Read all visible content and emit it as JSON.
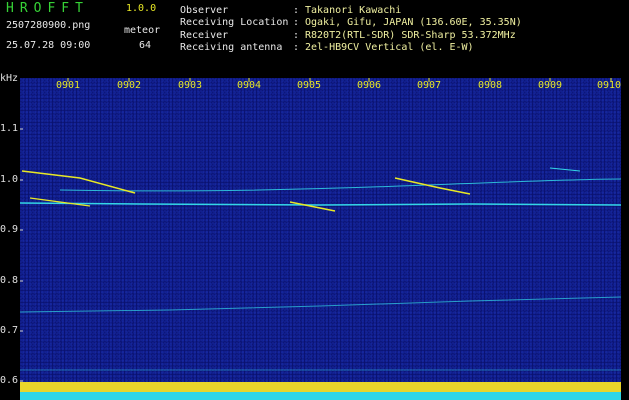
{
  "header": {
    "app_title": "HROFFT",
    "version": "1.0.0",
    "filename": "2507280900.png",
    "meteor_label": "meteor",
    "timestamp": "25.07.28 09:00",
    "meteor_count": "64"
  },
  "info": [
    {
      "key": "Observer",
      "sep": ":",
      "value": "Takanori Kawachi"
    },
    {
      "key": "Receiving Location",
      "sep": ":",
      "value": "Ogaki, Gifu, JAPAN (136.60E, 35.35N)"
    },
    {
      "key": "Receiver",
      "sep": ":",
      "value": "R820T2(RTL-SDR) SDR-Sharp 53.372MHz"
    },
    {
      "key": "Receiving antenna",
      "sep": ":",
      "value": "2el-HB9CV Vertical (el. E-W)"
    }
  ],
  "axis": {
    "unit": "kHz",
    "y_ticks": [
      "1.1",
      "1.0",
      "0.9",
      "0.8",
      "0.7",
      "0.6"
    ],
    "x_ticks": [
      "0901",
      "0902",
      "0903",
      "0904",
      "0905",
      "0906",
      "0907",
      "0908",
      "0909",
      "0910"
    ]
  },
  "colors": {
    "background": "#000000",
    "spectrogram_bg": "#0a1270",
    "trace": "#33d6e6",
    "meteor_trace": "#e8e825",
    "tick_label": "#e8e825"
  }
}
